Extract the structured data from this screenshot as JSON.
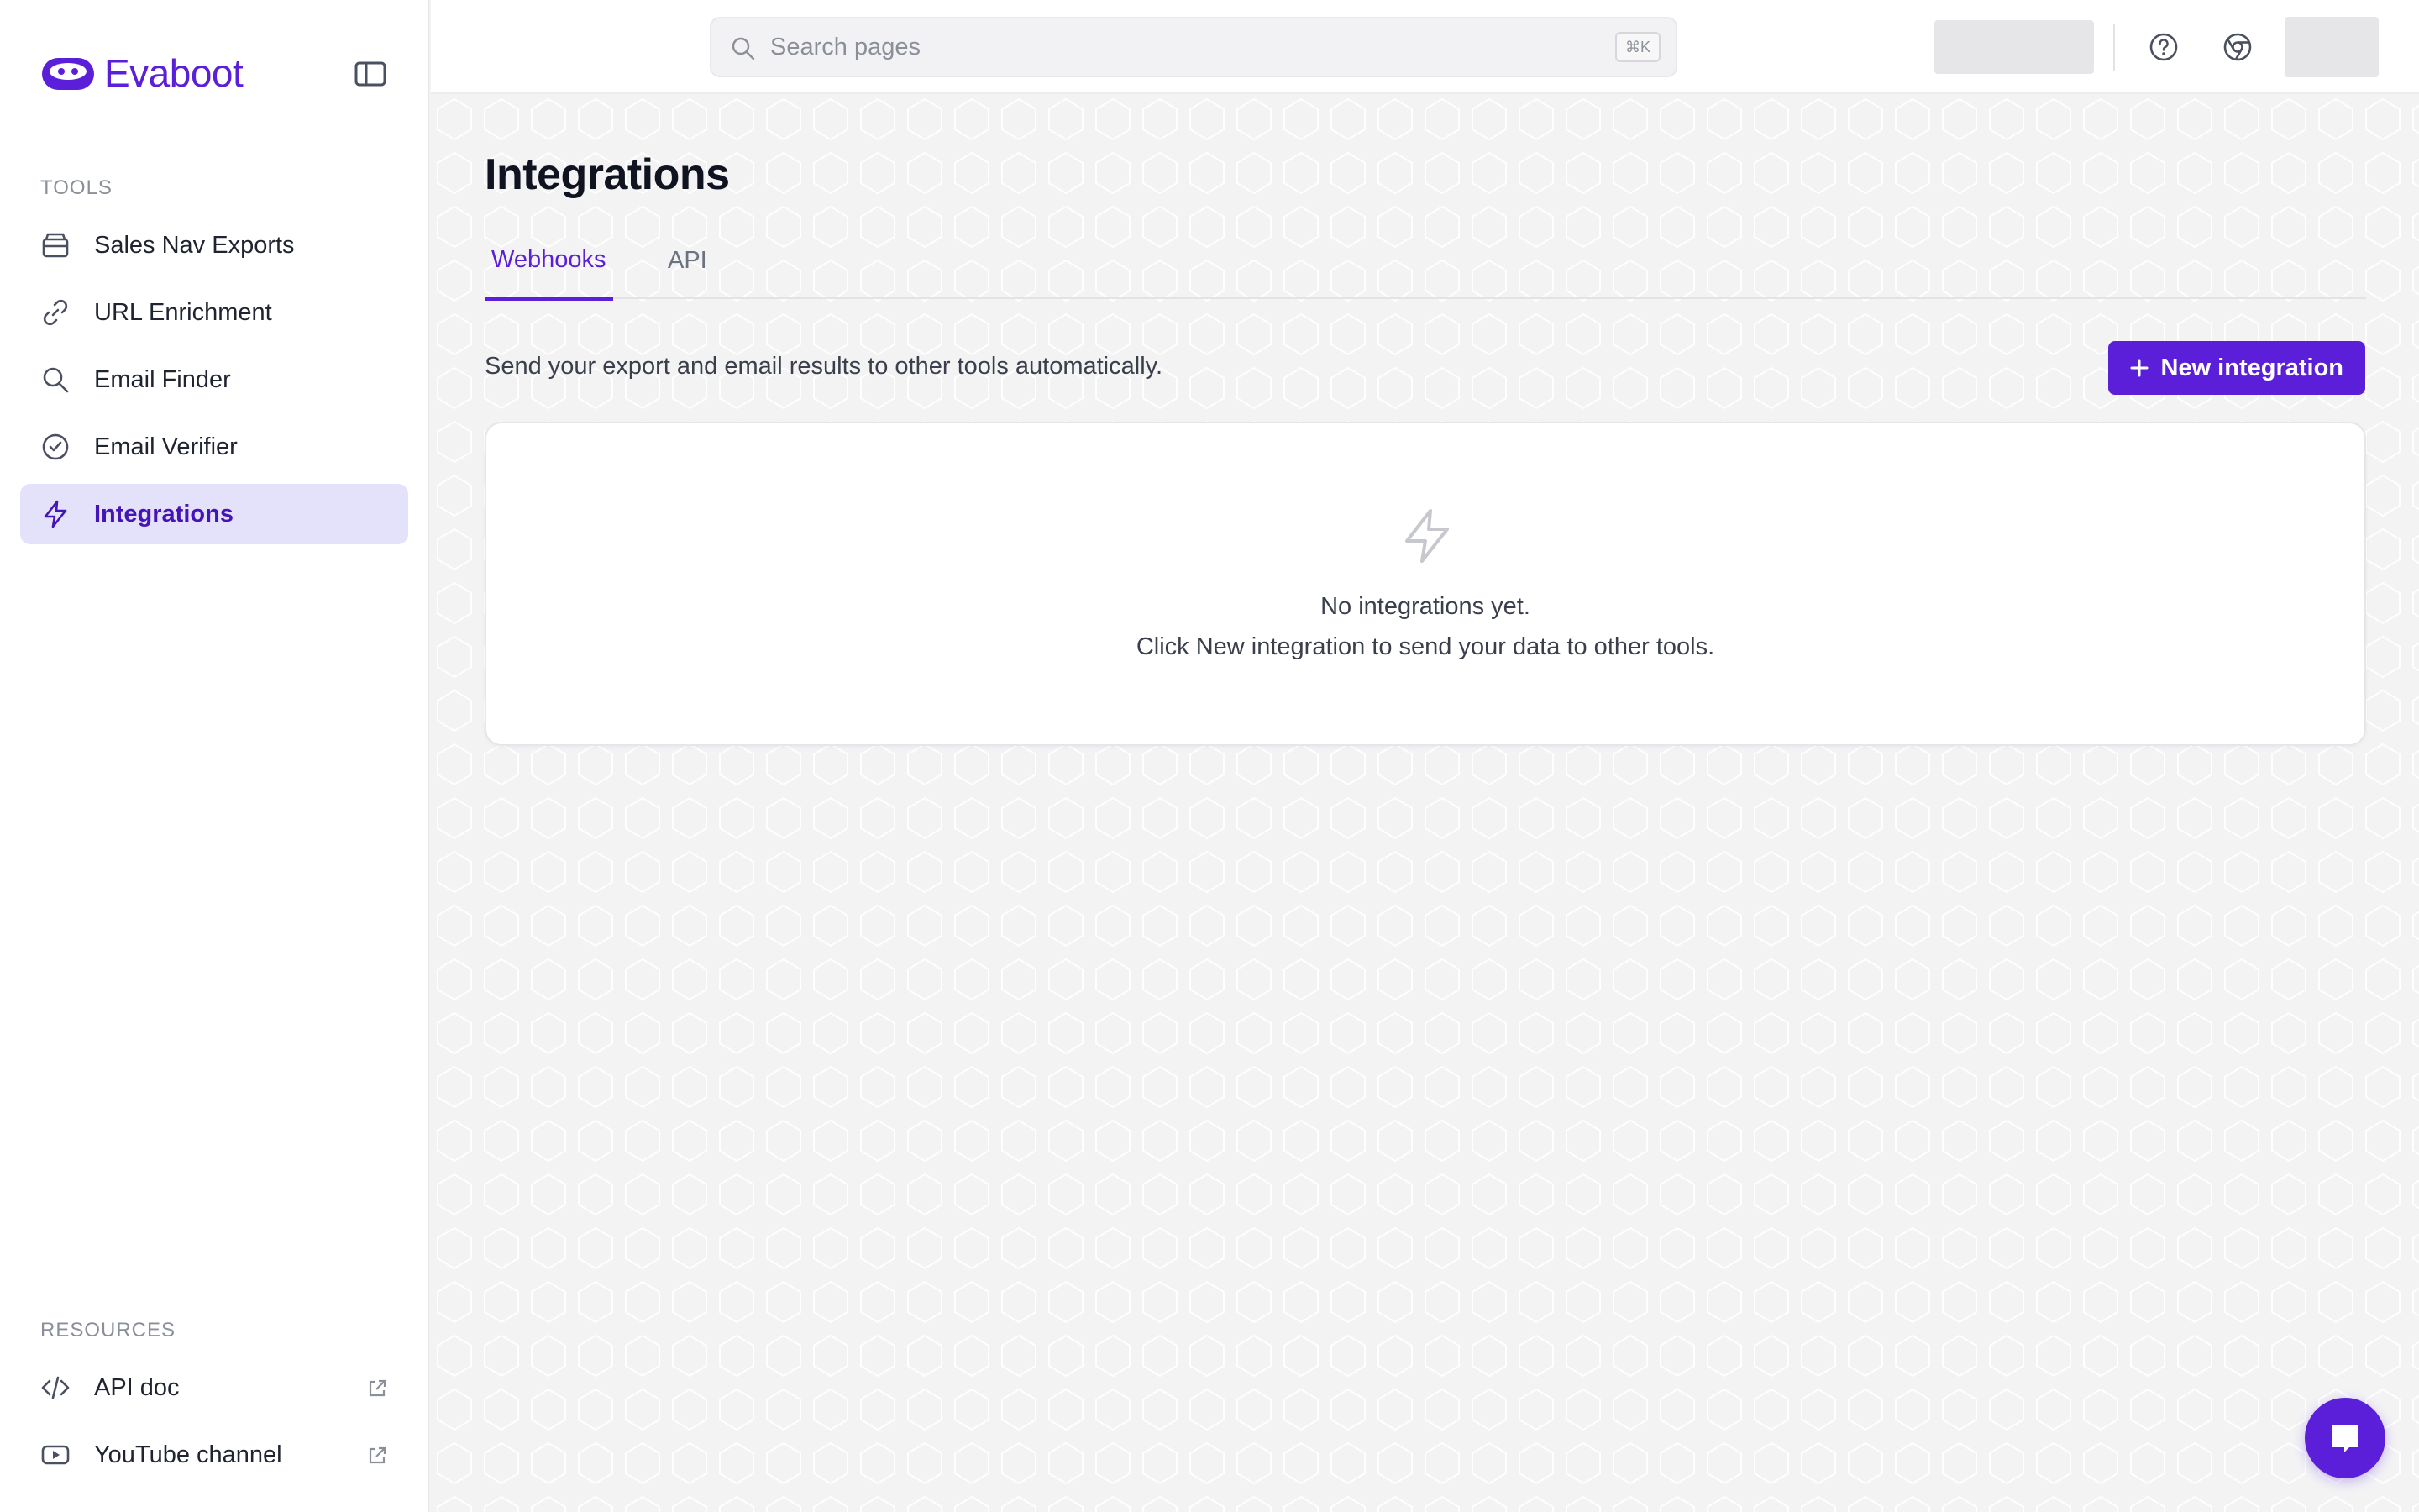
{
  "app": {
    "name": "Evaboot",
    "brand_color": "#5b1fd9",
    "accent_light": "#e4e1fb"
  },
  "sidebar": {
    "tools_heading": "TOOLS",
    "items": [
      {
        "label": "Sales Nav Exports",
        "icon": "inbox-icon",
        "active": false
      },
      {
        "label": "URL Enrichment",
        "icon": "link-icon",
        "active": false
      },
      {
        "label": "Email Finder",
        "icon": "search-icon",
        "active": false
      },
      {
        "label": "Email Verifier",
        "icon": "check-circle-icon",
        "active": false
      },
      {
        "label": "Integrations",
        "icon": "lightning-icon",
        "active": true
      }
    ],
    "resources_heading": "RESOURCES",
    "resources": [
      {
        "label": "API doc",
        "icon": "code-icon",
        "external": true
      },
      {
        "label": "YouTube channel",
        "icon": "youtube-icon",
        "external": true
      }
    ]
  },
  "topbar": {
    "search_placeholder": "Search pages",
    "search_shortcut": "⌘K",
    "icons": [
      "help-icon",
      "chrome-icon"
    ]
  },
  "page": {
    "title": "Integrations",
    "tabs": [
      {
        "label": "Webhooks",
        "active": true
      },
      {
        "label": "API",
        "active": false
      }
    ],
    "description": "Send your export and email results to other tools automatically.",
    "new_button_label": "New integration",
    "empty_state": {
      "icon": "lightning-icon",
      "line1": "No integrations yet.",
      "line2": "Click New integration to send your data to other tools."
    }
  },
  "chat": {
    "icon": "chat-icon"
  }
}
